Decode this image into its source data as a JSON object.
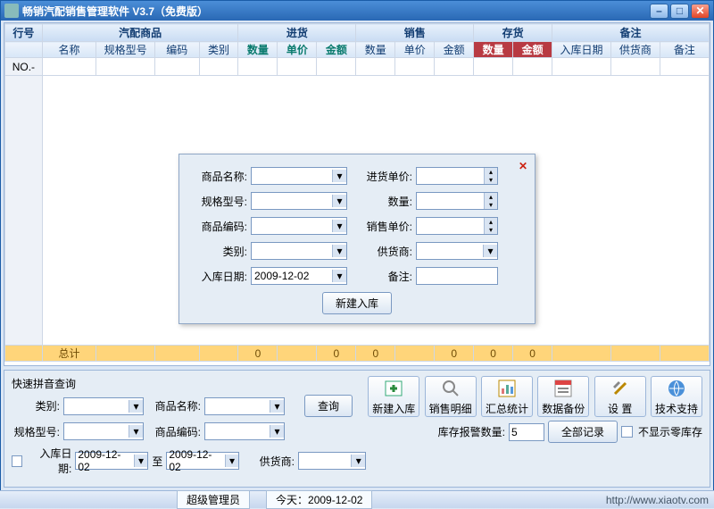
{
  "window": {
    "title": "畅销汽配销售管理软件  V3.7（免费版）"
  },
  "grid": {
    "row_header": "行号",
    "groups": [
      "汽配商品",
      "进货",
      "销售",
      "存货",
      "备注"
    ],
    "columns": [
      "名称",
      "规格型号",
      "编码",
      "类别",
      "数量",
      "单价",
      "金额",
      "数量",
      "单价",
      "金额",
      "数量",
      "金额",
      "入库日期",
      "供货商",
      "备注"
    ],
    "first_row_label": "NO.-",
    "totals_label": "总计",
    "totals": [
      "0",
      "0",
      "0",
      "0",
      "0",
      "0"
    ]
  },
  "dialog": {
    "labels": {
      "name": "商品名称:",
      "spec": "规格型号:",
      "code": "商品编码:",
      "cat": "类别:",
      "date": "入库日期:",
      "inprice": "进货单价:",
      "qty": "数量:",
      "saleprice": "销售单价:",
      "supplier": "供货商:",
      "remark": "备注:"
    },
    "date_value": "2009-12-02",
    "submit": "新建入库"
  },
  "query": {
    "title": "快速拼音查询",
    "labels": {
      "cat": "类别:",
      "name": "商品名称:",
      "spec": "规格型号:",
      "code": "商品编码:",
      "date": "入库日期:",
      "to": "至",
      "supplier": "供货商:"
    },
    "date_from": "2009-12-02",
    "date_to": "2009-12-02",
    "search": "查询"
  },
  "buttons": {
    "new": "新建入库",
    "detail": "销售明细",
    "summary": "汇总统计",
    "backup": "数据备份",
    "settings": "设 置",
    "support": "技术支持"
  },
  "bottom": {
    "alarm_label": "库存报警数量:",
    "alarm_value": "5",
    "all": "全部记录",
    "hide_zero": "不显示零库存"
  },
  "status": {
    "user": "超级管理员",
    "today_label": "今天：",
    "today": "2009-12-02",
    "url": "http://www.xiaotv.com"
  }
}
